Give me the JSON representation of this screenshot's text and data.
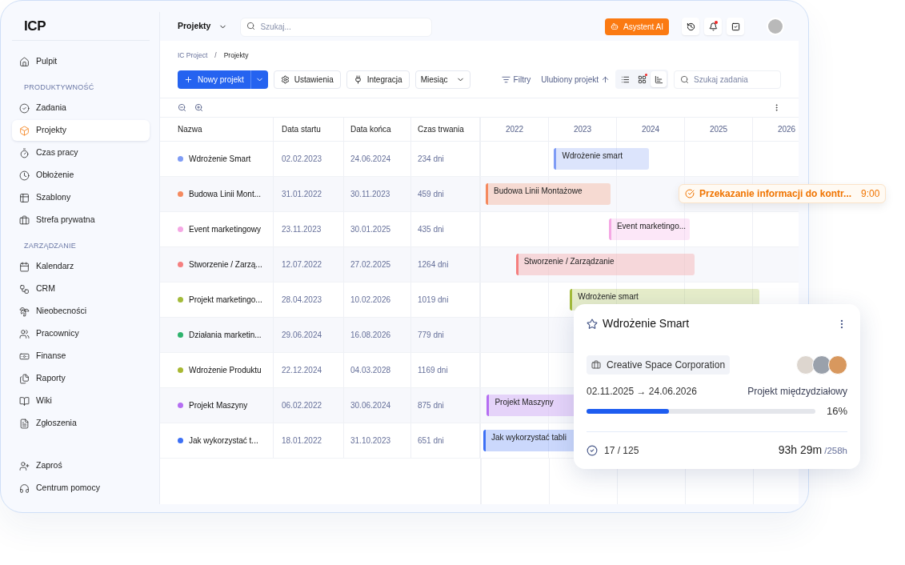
{
  "sidebar": {
    "logo": "ICP",
    "groups": [
      {
        "items": [
          {
            "label": "Pulpit",
            "selected": false
          }
        ]
      },
      {
        "heading": "PRODUKTYWNOŚĆ",
        "items": [
          {
            "label": "Zadania",
            "selected": false
          },
          {
            "label": "Projekty",
            "selected": true
          },
          {
            "label": "Czas pracy",
            "selected": false
          },
          {
            "label": "Obłożenie",
            "selected": false
          },
          {
            "label": "Szablony",
            "selected": false
          },
          {
            "label": "Strefa prywatna",
            "selected": false
          }
        ]
      },
      {
        "heading": "ZARZĄDZANIE",
        "items": [
          {
            "label": "Kalendarz",
            "selected": false
          },
          {
            "label": "CRM",
            "selected": false
          },
          {
            "label": "Nieobecności",
            "selected": false
          },
          {
            "label": "Pracownicy",
            "selected": false
          },
          {
            "label": "Finanse",
            "selected": false
          },
          {
            "label": "Raporty",
            "selected": false
          },
          {
            "label": "Wiki",
            "selected": false
          },
          {
            "label": "Zgłoszenia",
            "selected": false
          }
        ]
      },
      {
        "items": [
          {
            "label": "Zaproś",
            "selected": false
          },
          {
            "label": "Centrum pomocy",
            "selected": false
          }
        ]
      }
    ]
  },
  "topbar": {
    "workspace": "Projekty",
    "search_placeholder": "Szukaj...",
    "assistant": "Asystent AI",
    "notification_badge": true
  },
  "toolbar": {
    "breadcrumb": [
      "IC Project",
      "Projekty"
    ],
    "breadcrumb_separator": "/",
    "new_button": "Nowy projekt",
    "buttons": [
      "Ustawienia",
      "Integracja"
    ],
    "period": "Miesiąc",
    "filters": "Filtry",
    "sort": "Ulubiony projekt",
    "views": [
      {
        "selected": false,
        "badge": false
      },
      {
        "selected": false,
        "badge": true
      },
      {
        "selected": true,
        "badge": false
      }
    ],
    "task_search_placeholder": "Szukaj zadania"
  },
  "table": {
    "columns": [
      "Nazwa",
      "Data startu",
      "Data końca",
      "Czas trwania"
    ],
    "years": [
      "2022",
      "2023",
      "2024",
      "2025",
      "2026"
    ],
    "rows": [
      {
        "name": "Wdrożenie Smart",
        "color": "#7f9cf5",
        "start": "02.02.2023",
        "end": "24.06.2024",
        "duration": "234 dni",
        "bar": "Wdrożenie smart"
      },
      {
        "name": "Budowa Linii Mont...",
        "color": "#f58a5f",
        "start": "31.01.2022",
        "end": "30.11.2023",
        "duration": "459 dni",
        "bar": "Budowa Linii Montażowe"
      },
      {
        "name": "Event marketingowy",
        "color": "#f5a8e4",
        "start": "23.11.2023",
        "end": "30.01.2025",
        "duration": "435 dni",
        "bar": "Event marketingo..."
      },
      {
        "name": "Stworzenie / Zarzą...",
        "color": "#f57f7f",
        "start": "12.07.2022",
        "end": "27.02.2025",
        "duration": "1264 dni",
        "bar": "Stworzenie / Zarządzanie"
      },
      {
        "name": "Projekt marketingo...",
        "color": "#a3bb3a",
        "start": "28.04.2023",
        "end": "10.02.2026",
        "duration": "1019 dni",
        "bar": "Wdrożenie smart"
      },
      {
        "name": "Działania marketin...",
        "color": "#2fb36d",
        "start": "29.06.2024",
        "end": "16.08.2026",
        "duration": "779 dni"
      },
      {
        "name": "Wdrożenie Produktu",
        "color": "#a8b832",
        "start": "22.12.2024",
        "end": "04.03.2028",
        "duration": "1169 dni"
      },
      {
        "name": "Projekt Maszyny",
        "color": "#b56ef2",
        "start": "06.02.2022",
        "end": "30.06.2024",
        "duration": "875 dni",
        "bar": "Projekt Maszyny"
      },
      {
        "name": "Jak wykorzystać t...",
        "color": "#3d70f5",
        "start": "18.01.2022",
        "end": "31.10.2023",
        "duration": "651 dni",
        "bar": "Jak wykorzystać tabli"
      }
    ]
  },
  "toast": {
    "text": "Przekazanie informacji do kontr...",
    "time": "9:00"
  },
  "card": {
    "title": "Wdrożenie Smart",
    "starred": false,
    "client": "Creative Space Corporation",
    "dates": "02.11.2025 → 24.06.2026",
    "type": "Projekt międzydziałowy",
    "level": 0.36,
    "percent": "16%",
    "tasks": "17 / 125",
    "time_spent": "93h 29m",
    "time_total": "/258h"
  }
}
